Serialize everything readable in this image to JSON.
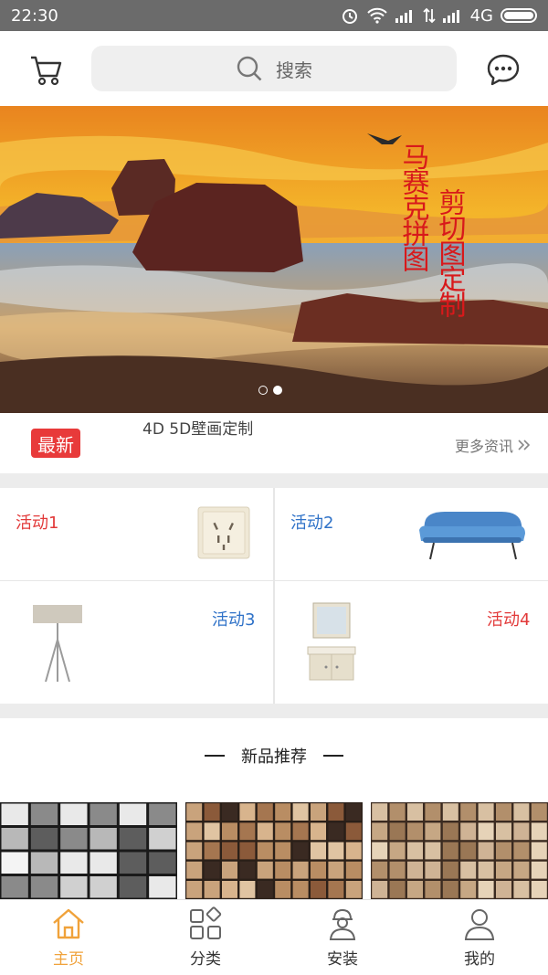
{
  "status_bar": {
    "time": "22:30",
    "network": "4G"
  },
  "header": {
    "search_placeholder": "搜索"
  },
  "banner": {
    "calligraphy_left": "马赛克拼图",
    "calligraphy_right": "剪切图定制",
    "page_count": 2,
    "active_page": 2
  },
  "news": {
    "badge": "最新",
    "headline": "4D 5D壁画定制",
    "more_label": "更多资讯"
  },
  "activities": [
    {
      "label": "活动1",
      "color": "#e23a3a",
      "image": "wall-socket"
    },
    {
      "label": "活动2",
      "color": "#2f72c8",
      "image": "blue-sofa"
    },
    {
      "label": "活动3",
      "color": "#2f72c8",
      "image": "floor-lamp"
    },
    {
      "label": "活动4",
      "color": "#e23a3a",
      "image": "bathroom-vanity"
    }
  ],
  "recommend": {
    "title": "新品推荐"
  },
  "products": [
    {
      "image": "newspaper-mosaic-tile"
    },
    {
      "image": "brown-stone-mosaic-tile"
    },
    {
      "image": "beige-marble-mosaic-tile"
    }
  ],
  "tabs": [
    {
      "label": "主页",
      "icon": "home-icon",
      "active": true
    },
    {
      "label": "分类",
      "icon": "category-icon",
      "active": false
    },
    {
      "label": "安装",
      "icon": "worker-icon",
      "active": false
    },
    {
      "label": "我的",
      "icon": "user-icon",
      "active": false
    }
  ],
  "colors": {
    "accent": "#f0a23a",
    "badge_red": "#e83a3a",
    "activity_red": "#e23a3a",
    "activity_blue": "#2f72c8"
  }
}
